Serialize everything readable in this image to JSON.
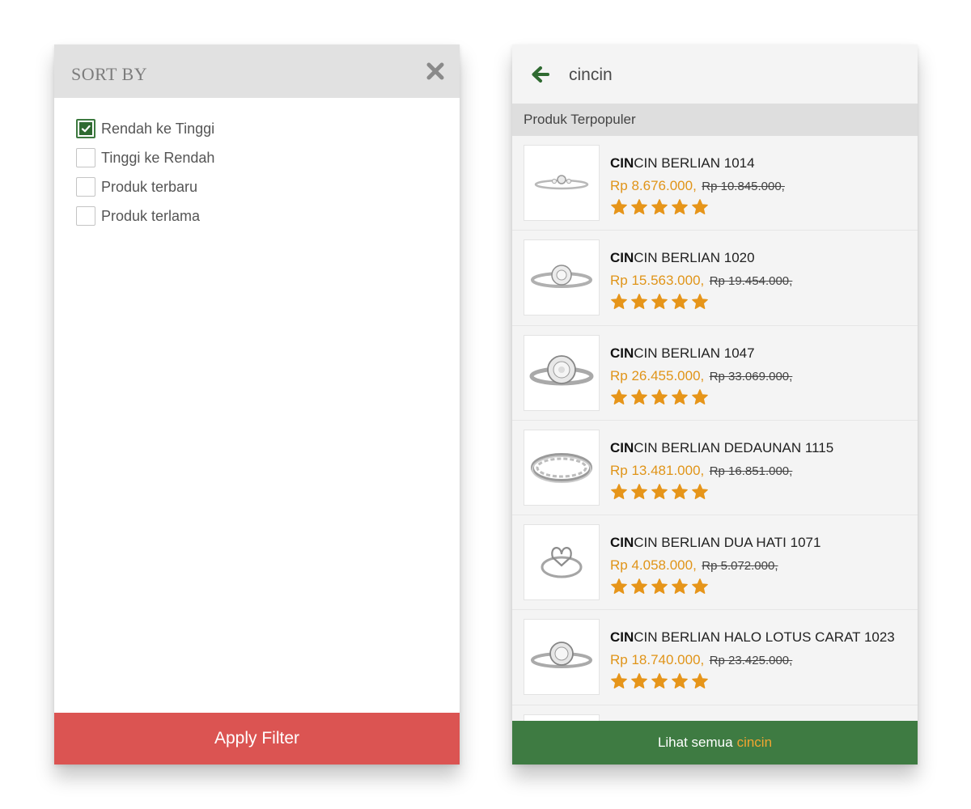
{
  "sort_panel": {
    "title": "SORT BY",
    "close_icon": "close-icon",
    "options": [
      {
        "label": "Rendah ke Tinggi",
        "checked": true
      },
      {
        "label": "Tinggi ke Rendah",
        "checked": false
      },
      {
        "label": "Produk terbaru",
        "checked": false
      },
      {
        "label": "Produk terlama",
        "checked": false
      }
    ],
    "apply_label": "Apply Filter",
    "apply_color": "#db5452"
  },
  "search_panel": {
    "back_icon": "arrow-left-icon",
    "query": "cincin",
    "section_title": "Produk Terpopuler",
    "rating_icon": "star-icon",
    "products": [
      {
        "highlight": "CIN",
        "name_rest": "CIN BERLIAN 1014",
        "price": "Rp 8.676.000,",
        "old_price": "Rp 10.845.000,",
        "stars": 5
      },
      {
        "highlight": "CIN",
        "name_rest": "CIN BERLIAN 1020",
        "price": "Rp 15.563.000,",
        "old_price": "Rp 19.454.000,",
        "stars": 5
      },
      {
        "highlight": "CIN",
        "name_rest": "CIN BERLIAN 1047",
        "price": "Rp 26.455.000,",
        "old_price": "Rp 33.069.000,",
        "stars": 5
      },
      {
        "highlight": "CIN",
        "name_rest": "CIN BERLIAN DEDAUNAN 1115",
        "price": "Rp 13.481.000,",
        "old_price": "Rp 16.851.000,",
        "stars": 5
      },
      {
        "highlight": "CIN",
        "name_rest": "CIN BERLIAN DUA HATI 1071",
        "price": "Rp 4.058.000,",
        "old_price": "Rp 5.072.000,",
        "stars": 5
      },
      {
        "highlight": "CIN",
        "name_rest": "CIN BERLIAN HALO LOTUS CARAT 1023",
        "price": "Rp 18.740.000,",
        "old_price": "Rp 23.425.000,",
        "stars": 5
      }
    ],
    "see_all_prefix": "Lihat semua",
    "see_all_term": "cincin"
  },
  "colors": {
    "accent_green": "#3e7b42",
    "price_orange": "#e09418",
    "star_orange": "#e6951a",
    "header_grey": "#e1e1e1"
  }
}
